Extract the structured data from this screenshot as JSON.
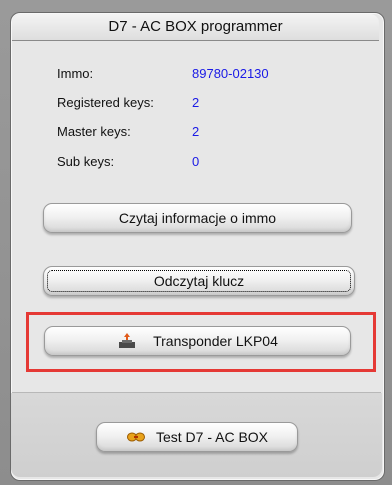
{
  "window": {
    "title": "D7 - AC BOX programmer"
  },
  "info": [
    {
      "label": "Immo:",
      "value": "89780-02130"
    },
    {
      "label": "Registered keys:",
      "value": "2"
    },
    {
      "label": "Master keys:",
      "value": "2"
    },
    {
      "label": "Sub keys:",
      "value": "0"
    }
  ],
  "buttons": {
    "read_immo": "Czytaj informacje o immo",
    "read_key": "Odczytaj klucz",
    "transponder": "Transponder LKP04",
    "test_box": "Test D7 - AC BOX"
  },
  "colors": {
    "value_text": "#1a1ae6",
    "highlight": "#e53935"
  },
  "icons": {
    "transponder": "transponder-chip-icon",
    "test": "box-connector-icon"
  }
}
